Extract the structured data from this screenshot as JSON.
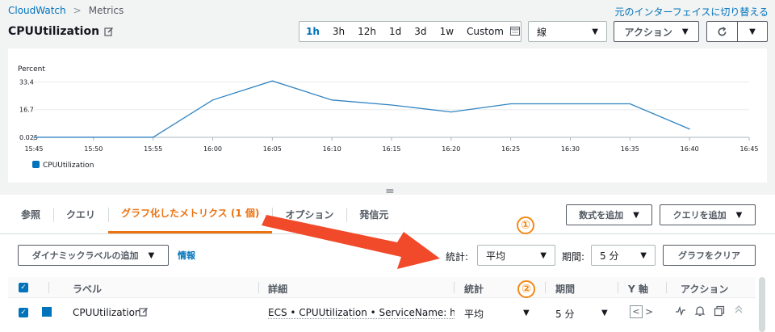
{
  "breadcrumb": {
    "root": "CloudWatch",
    "current": "Metrics"
  },
  "switch_link": "元のインターフェイスに切り替える",
  "title": "CPUUtilization",
  "time_ranges": [
    "1h",
    "3h",
    "12h",
    "1d",
    "3d",
    "1w"
  ],
  "time_range_active": "1h",
  "custom_label": "Custom",
  "chart_type_select": "線",
  "actions_button": "アクション",
  "refresh_icon": "refresh-icon",
  "chart_data": {
    "type": "line",
    "ylabel": "Percent",
    "yticks": [
      "33.4",
      "16.7",
      "0.025"
    ],
    "yticks_values": [
      33.4,
      16.7,
      0.025
    ],
    "ylim": [
      0,
      38
    ],
    "xticks": [
      "15:45",
      "15:50",
      "15:55",
      "16:00",
      "16:05",
      "16:10",
      "16:15",
      "16:20",
      "16:25",
      "16:30",
      "16:35",
      "16:40",
      "16:45"
    ],
    "x": [
      "15:45",
      "15:50",
      "15:55",
      "16:00",
      "16:05",
      "16:10",
      "16:15",
      "16:20",
      "16:25",
      "16:30",
      "16:35",
      "16:40"
    ],
    "series": [
      {
        "name": "CPUUtilization",
        "color": "#3184c2",
        "values": [
          0.025,
          0.025,
          0.025,
          22.5,
          34.0,
          22.5,
          19.5,
          15.3,
          20.2,
          20.2,
          20.2,
          5.0
        ]
      }
    ],
    "legend": "bottom-left",
    "grid": true
  },
  "tabs": [
    "参照",
    "クエリ",
    "グラフ化したメトリクス (1 個)",
    "オプション",
    "発信元"
  ],
  "tab_active": "グラフ化したメトリクス (1 個)",
  "add_math_button": "数式を追加",
  "add_query_button": "クエリを追加",
  "dynamic_label_button": "ダイナミックラベルの追加",
  "info_link": "情報",
  "stat_label": "統計:",
  "stat_value": "平均",
  "period_label": "期間:",
  "period_value": "5 分",
  "clear_graph_button": "グラフをクリア",
  "annotations": [
    "①",
    "②"
  ],
  "table": {
    "headers": [
      "ラベル",
      "詳細",
      "統計",
      "期間",
      "Y 軸",
      "アクション"
    ],
    "rows": [
      {
        "label": "CPUUtilization",
        "details": "ECS • CPUUtilization • ServiceName: hato-ser",
        "stat": "平均",
        "period": "5 分",
        "yaxis_left": "<",
        "yaxis_right": ">",
        "color": "#0073bb"
      }
    ]
  },
  "colors": {
    "accent": "#ec7211",
    "link": "#0073bb",
    "annotation": "#f28a17",
    "arrow": "#f04a2a"
  }
}
